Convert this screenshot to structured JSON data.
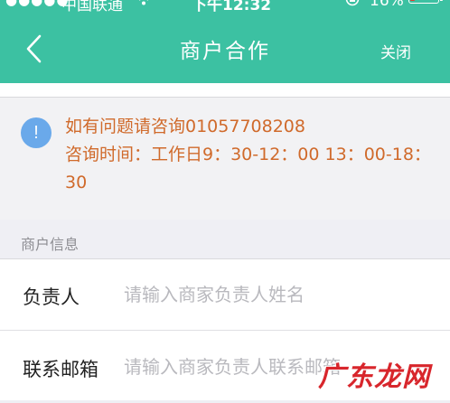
{
  "status_bar": {
    "signal": "●●●●●",
    "carrier": "中国联通",
    "wifi_icon": "wifi-icon",
    "time": "下午12:32",
    "orientation_lock_icon": "orientation-lock-icon",
    "battery_percent": "16%",
    "battery_level": 0.16,
    "battery_color": "#e53a2f"
  },
  "header": {
    "title": "商户合作",
    "close_label": "关闭",
    "back_icon": "chevron-left-icon",
    "background": "#3cc1a2"
  },
  "notice": {
    "icon": "info-icon",
    "icon_glyph": "!",
    "line1": "如有问题请咨询01057708208",
    "line2": "咨询时间：工作日9：30-12：00 13：00-18：30",
    "text_color": "#d06a2b"
  },
  "section": {
    "label": "商户信息"
  },
  "form": {
    "rows": [
      {
        "label": "负责人",
        "placeholder": "请输入商家负责人姓名",
        "value": ""
      },
      {
        "label": "联系邮箱",
        "placeholder": "请输入商家负责人联系邮箱",
        "value": ""
      }
    ]
  },
  "watermark": {
    "text": "广东龙网"
  }
}
